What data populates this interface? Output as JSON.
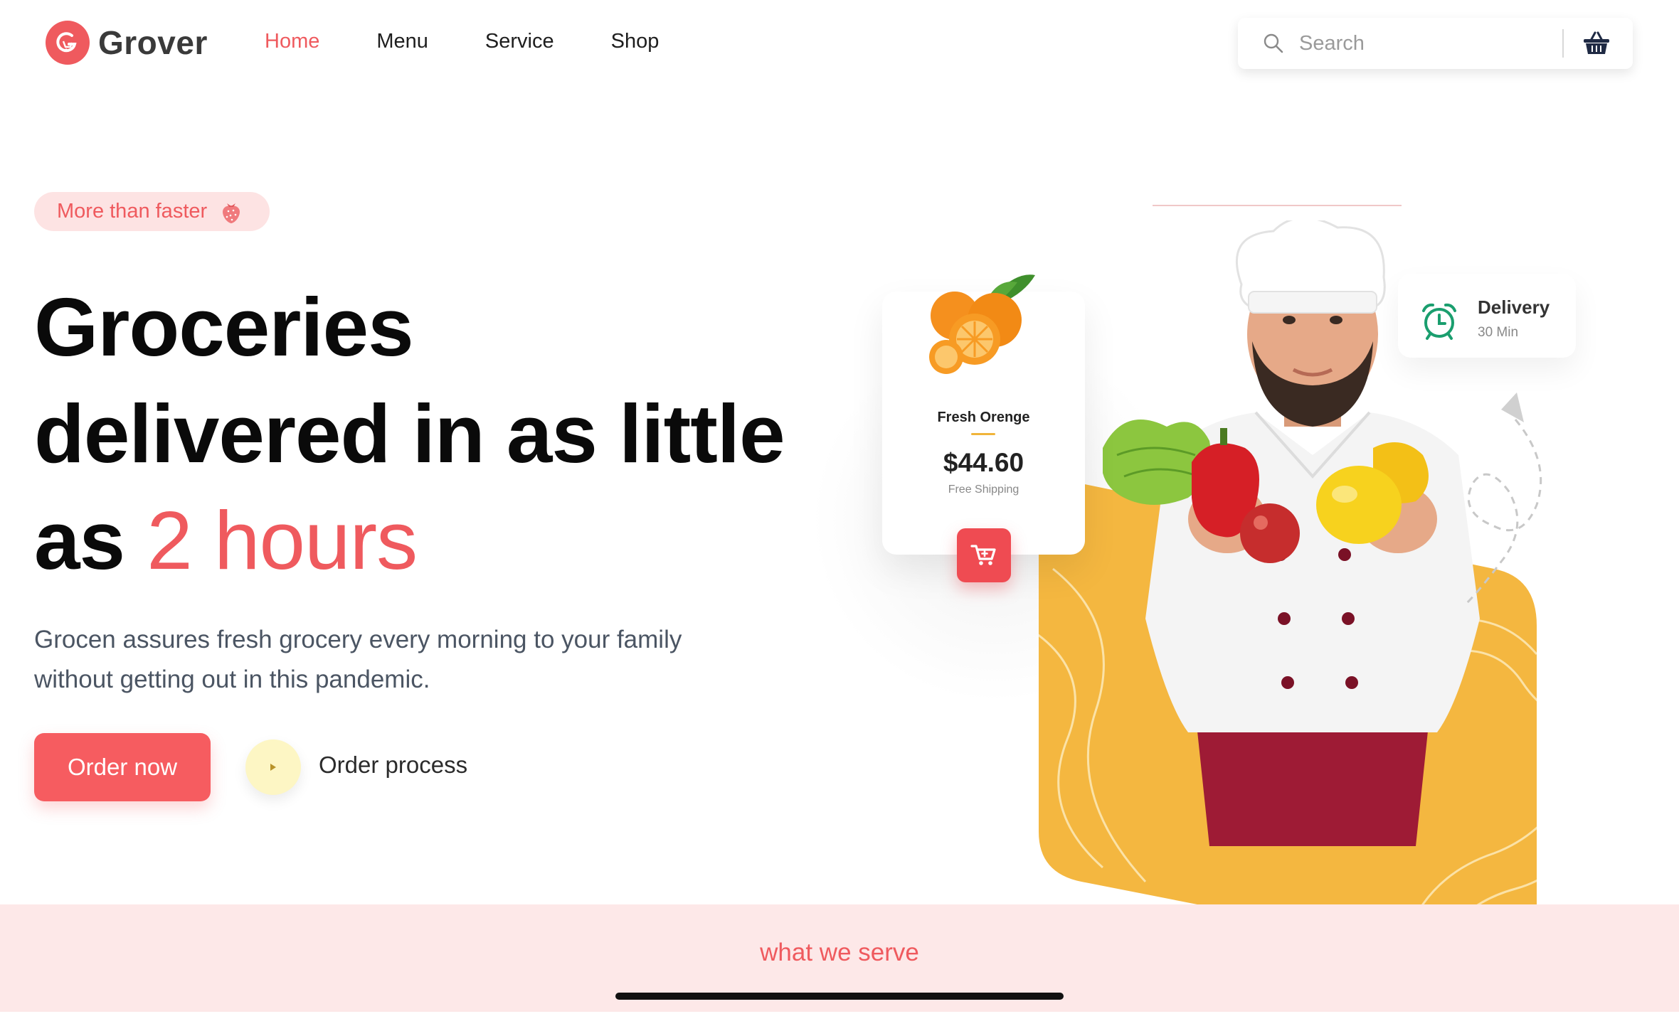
{
  "brand": {
    "name": "Grover",
    "logo_icon": "grover-logo-icon",
    "accent": "#ef5a5e"
  },
  "nav": {
    "items": [
      {
        "label": "Home",
        "active": true
      },
      {
        "label": "Menu",
        "active": false
      },
      {
        "label": "Service",
        "active": false
      },
      {
        "label": "Shop",
        "active": false
      }
    ]
  },
  "search": {
    "placeholder": "Search",
    "value": "",
    "icon": "search-icon"
  },
  "cart": {
    "icon": "basket-icon"
  },
  "hero": {
    "tagline": "More than faster",
    "tagline_icon": "strawberry-icon",
    "title_line1": "Groceries",
    "title_line2": "delivered in as little",
    "title_line3_prefix": "as ",
    "title_highlight": "2 hours",
    "description": "Grocen assures fresh grocery every morning to your family without getting out in this pandemic.",
    "order_button": "Order now",
    "process_label": "Order process",
    "play_icon": "play-icon"
  },
  "product_card": {
    "name": "Fresh Orenge",
    "price": "$44.60",
    "shipping": "Free Shipping",
    "cart_icon": "add-to-cart-icon"
  },
  "delivery_card": {
    "title": "Delivery",
    "time": "30 Min",
    "icon": "alarm-clock-icon",
    "icon_color": "#1a9e6e"
  },
  "section": {
    "label": "what we serve",
    "background": "#fde8e8"
  },
  "colors": {
    "accent": "#ef5a5e",
    "button": "#f65c60",
    "yellow": "#f4b740",
    "text_dark": "#0a0a0a",
    "text_muted": "#4b5563"
  }
}
